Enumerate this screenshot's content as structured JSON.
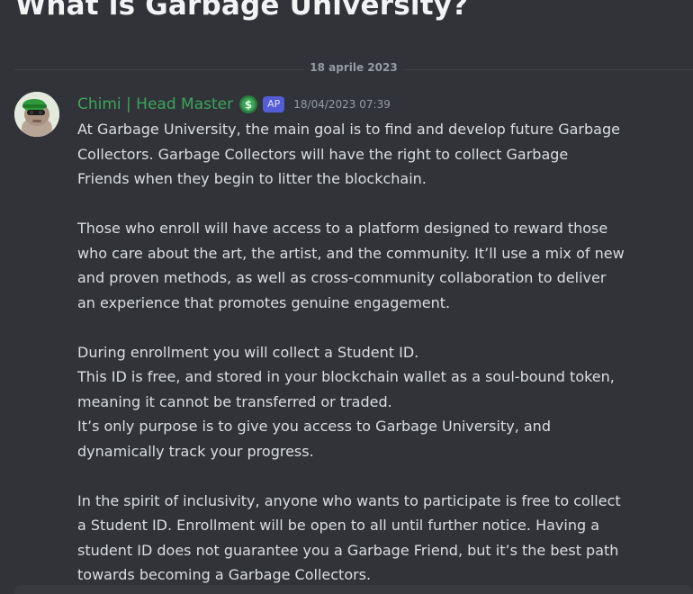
{
  "page": {
    "title": "What is Garbage University?"
  },
  "divider": {
    "date": "18 aprile 2023"
  },
  "message": {
    "author": "Chimi | Head Master",
    "author_color": "#3ba55c",
    "role_icon": "dollar-badge-icon",
    "tag": "AP",
    "timestamp": "18/04/2023 07:39",
    "paragraphs": [
      [
        "At Garbage University, the main goal is to find and develop future Garbage",
        "Collectors. Garbage Collectors will have the right to collect Garbage",
        "Friends when they begin to litter the blockchain."
      ],
      [
        "Those who enroll will have access to a platform designed to reward those",
        "who care about the art, the artist, and the community. It’ll use a mix of new",
        "and proven methods, as well as cross-community collaboration to deliver",
        "an experience that promotes genuine engagement."
      ],
      [
        "During enrollment you will collect a Student ID.",
        "This ID is free, and stored in your blockchain wallet as a soul-bound token,",
        "meaning it cannot be transferred or traded.",
        "It’s only purpose is to give you access to Garbage University, and",
        "dynamically track your progress."
      ],
      [
        "In the spirit of inclusivity, anyone who wants to participate is free to collect",
        "a Student ID. Enrollment will be open to all until further notice. Having a",
        "student ID does not guarantee you a Garbage Friend, but it’s the best path",
        "towards becoming a Garbage Collectors."
      ]
    ]
  },
  "colors": {
    "background": "#313338",
    "text": "#dbdee1",
    "muted": "#949ba4",
    "tag": "#5865f2"
  }
}
